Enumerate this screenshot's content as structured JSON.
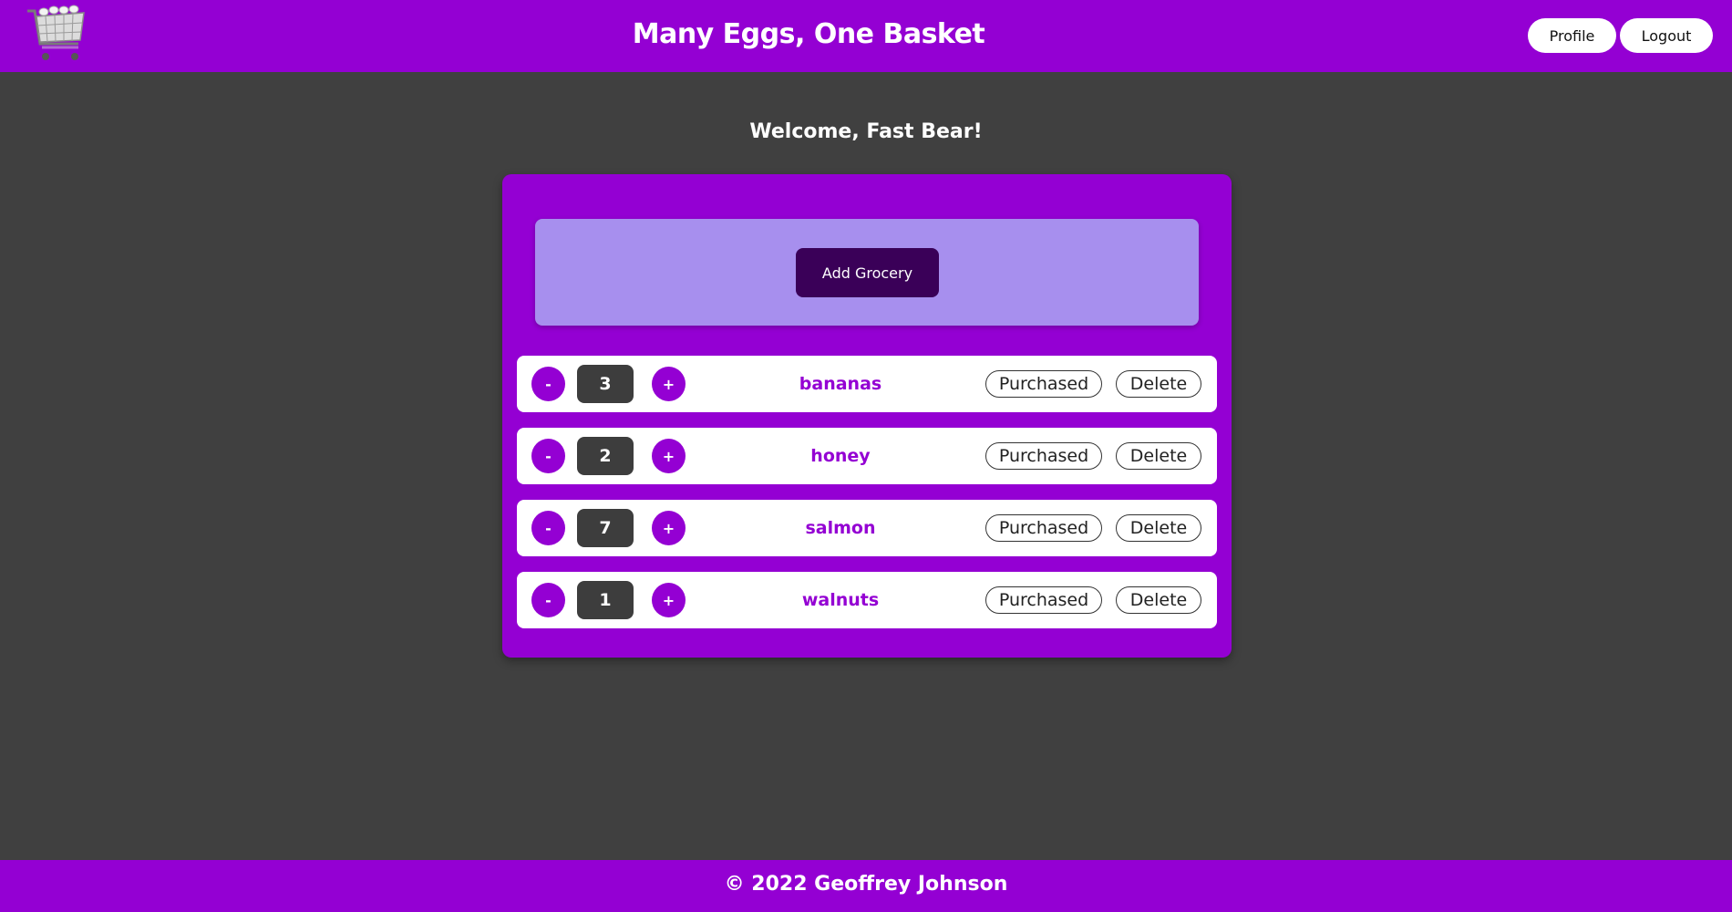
{
  "header": {
    "title": "Many Eggs, One Basket",
    "logo_icon": "shopping-cart-icon",
    "profile_label": "Profile",
    "logout_label": "Logout"
  },
  "welcome": "Welcome, Fast Bear!",
  "add_grocery_label": "Add Grocery",
  "groceries": [
    {
      "name": "bananas",
      "quantity": "3",
      "minus": "-",
      "plus": "+",
      "purchased": "Purchased",
      "delete": "Delete"
    },
    {
      "name": "honey",
      "quantity": "2",
      "minus": "-",
      "plus": "+",
      "purchased": "Purchased",
      "delete": "Delete"
    },
    {
      "name": "salmon",
      "quantity": "7",
      "minus": "-",
      "plus": "+",
      "purchased": "Purchased",
      "delete": "Delete"
    },
    {
      "name": "walnuts",
      "quantity": "1",
      "minus": "-",
      "plus": "+",
      "purchased": "Purchased",
      "delete": "Delete"
    }
  ],
  "footer": "© 2022 Geoffrey Johnson",
  "colors": {
    "brand": "#9400d3",
    "background": "#404040",
    "add_box": "#a78fee",
    "add_button": "#3a0058"
  }
}
